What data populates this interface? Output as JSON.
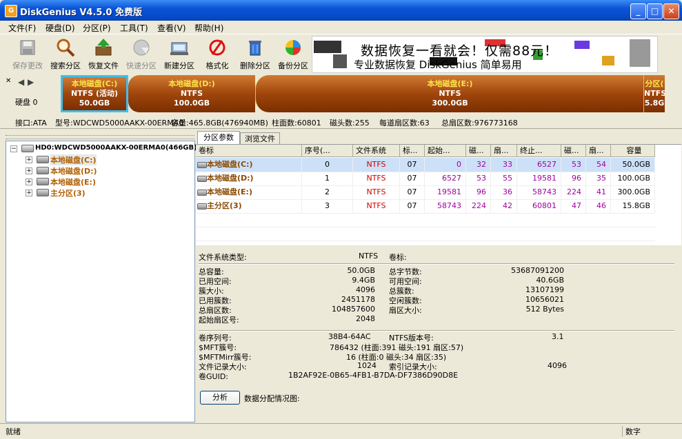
{
  "window": {
    "title": "DiskGenius V4.5.0 免费版"
  },
  "menu": [
    "文件(F)",
    "硬盘(D)",
    "分区(P)",
    "工具(T)",
    "查看(V)",
    "帮助(H)"
  ],
  "toolbar": [
    {
      "label": "保存更改",
      "icon": "save-icon",
      "disabled": true
    },
    {
      "label": "搜索分区",
      "icon": "search-icon",
      "disabled": false
    },
    {
      "label": "恢复文件",
      "icon": "restore-icon",
      "disabled": false
    },
    {
      "label": "快速分区",
      "icon": "quick-partition-icon",
      "disabled": true
    },
    {
      "label": "新建分区",
      "icon": "new-partition-icon",
      "disabled": false
    },
    {
      "label": "格式化",
      "icon": "format-icon",
      "disabled": false
    },
    {
      "label": "删除分区",
      "icon": "delete-icon",
      "disabled": false
    },
    {
      "label": "备份分区",
      "icon": "backup-icon",
      "disabled": false
    }
  ],
  "banner": {
    "line1": "数据恢复一看就会！仅需88元！",
    "line2": "专业数据恢复 DiskGenius 简单易用"
  },
  "disk_map": {
    "disk_label": "硬盘 0",
    "partitions": [
      {
        "name": "本地磁盘(C:)",
        "fs": "NTFS (活动)",
        "size": "50.0GB"
      },
      {
        "name": "本地磁盘(D:)",
        "fs": "NTFS",
        "size": "100.0GB"
      },
      {
        "name": "本地磁盘(E:)",
        "fs": "NTFS",
        "size": "300.0GB"
      },
      {
        "name": "分区(",
        "fs": "NTFS",
        "size": "5.8G"
      }
    ]
  },
  "disk_info": {
    "interface": "接口:ATA",
    "model": "型号:WDCWD5000AAKX-00ERMA0",
    "capacity": "容量:465.8GB(476940MB)",
    "cylinders": "柱面数:60801",
    "heads": "磁头数:255",
    "sectors": "每道扇区数:63",
    "total_sectors": "总扇区数:976773168"
  },
  "tree": {
    "root": "HD0:WDCWD5000AAKX-00ERMA0(466GB)",
    "items": [
      "本地磁盘(C:)",
      "本地磁盘(D:)",
      "本地磁盘(E:)",
      "主分区(3)"
    ]
  },
  "tabs": [
    "分区参数",
    "浏览文件"
  ],
  "table": {
    "headers": [
      "卷标",
      "序号(...",
      "文件系统",
      "标...",
      "起始...",
      "磁...",
      "扇...",
      "终止...",
      "磁...",
      "扇...",
      "容量"
    ],
    "rows": [
      [
        "本地磁盘(C:)",
        "0",
        "NTFS",
        "07",
        "0",
        "32",
        "33",
        "6527",
        "53",
        "54",
        "50.0GB"
      ],
      [
        "本地磁盘(D:)",
        "1",
        "NTFS",
        "07",
        "6527",
        "53",
        "55",
        "19581",
        "96",
        "35",
        "100.0GB"
      ],
      [
        "本地磁盘(E:)",
        "2",
        "NTFS",
        "07",
        "19581",
        "96",
        "36",
        "58743",
        "224",
        "41",
        "300.0GB"
      ],
      [
        "主分区(3)",
        "3",
        "NTFS",
        "07",
        "58743",
        "224",
        "42",
        "60801",
        "47",
        "46",
        "15.8GB"
      ]
    ]
  },
  "details": {
    "fs_type_label": "文件系统类型:",
    "fs_type": "NTFS",
    "volume_label": "卷标:",
    "left": [
      [
        "总容量:",
        "50.0GB"
      ],
      [
        "已用空间:",
        "9.4GB"
      ],
      [
        "簇大小:",
        "4096"
      ],
      [
        "已用簇数:",
        "2451178"
      ],
      [
        "总扇区数:",
        "104857600"
      ],
      [
        "起始扇区号:",
        "2048"
      ]
    ],
    "right": [
      [
        "总字节数:",
        "53687091200"
      ],
      [
        "可用空间:",
        "40.6GB"
      ],
      [
        "总簇数:",
        "13107199"
      ],
      [
        "空闲簇数:",
        "10656021"
      ],
      [
        "扇区大小:",
        "512 Bytes"
      ]
    ],
    "serial_label": "卷序列号:",
    "serial": "38B4-64AC",
    "ntfs_ver_label": "NTFS版本号:",
    "ntfs_ver": "3.1",
    "mft_label": "$MFT簇号:",
    "mft": "786432 (柱面:391 磁头:191 扇区:57)",
    "mftmirr_label": "$MFTMirr簇号:",
    "mftmirr": "16 (柱面:0 磁头:34 扇区:35)",
    "record_size_label": "文件记录大小:",
    "record_size": "1024",
    "index_size_label": "索引记录大小:",
    "index_size": "4096",
    "guid_label": "卷GUID:",
    "guid": "1B2AF92E-0B65-4FB1-B7DA-DF7386D90D8E",
    "analyze_button": "分析",
    "alloc_label": "数据分配情况图:"
  },
  "status": {
    "left": "就绪",
    "right": "数字"
  }
}
